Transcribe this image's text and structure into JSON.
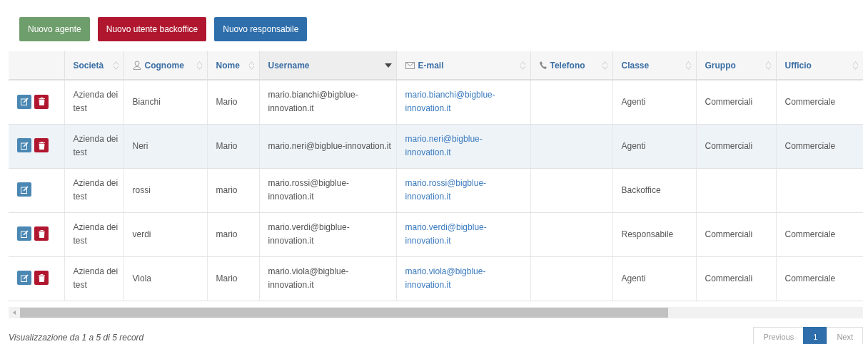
{
  "buttons": [
    {
      "label": "Nuovo agente",
      "color": "#6e9e6b"
    },
    {
      "label": "Nuovo utente backoffice",
      "color": "#b0172f"
    },
    {
      "label": "Nuovo responsabile",
      "color": "#2e6eab"
    }
  ],
  "table": {
    "columns": [
      {
        "label": "Società",
        "kind": "plain",
        "sorted": false
      },
      {
        "label": "Cognome",
        "kind": "user",
        "sorted": false
      },
      {
        "label": "Nome",
        "kind": "plain",
        "sorted": false
      },
      {
        "label": "Username",
        "kind": "plain",
        "sorted": true
      },
      {
        "label": "E-mail",
        "kind": "mail",
        "sorted": false
      },
      {
        "label": "Telefono",
        "kind": "phone",
        "sorted": false
      },
      {
        "label": "Classe",
        "kind": "plain",
        "sorted": false
      },
      {
        "label": "Gruppo",
        "kind": "plain",
        "sorted": false
      },
      {
        "label": "Ufficio",
        "kind": "plain",
        "sorted": false
      }
    ],
    "rows": [
      {
        "selected": false,
        "deletable": true,
        "cells": [
          "Azienda dei test",
          "Bianchi",
          "Mario",
          "mario.bianchi@bigblue-innovation.it",
          "mario.bianchi@bigblue-innovation.it",
          "",
          "Agenti",
          "Commerciali",
          "Commerciale"
        ]
      },
      {
        "selected": true,
        "deletable": true,
        "cells": [
          "Azienda dei test",
          "Neri",
          "Mario",
          "mario.neri@bigblue-innovation.it",
          "mario.neri@bigblue-innovation.it",
          "",
          "Agenti",
          "Commerciali",
          "Commerciale"
        ]
      },
      {
        "selected": false,
        "deletable": false,
        "cells": [
          "Azienda dei test",
          "rossi",
          "mario",
          "mario.rossi@bigblue-innovation.it",
          "mario.rossi@bigblue-innovation.it",
          "",
          "Backoffice",
          "",
          ""
        ]
      },
      {
        "selected": false,
        "deletable": true,
        "cells": [
          "Azienda dei test",
          "verdi",
          "mario",
          "mario.verdi@bigblue-innovation.it",
          "mario.verdi@bigblue-innovation.it",
          "",
          "Responsabile",
          "Commerciali",
          "Commerciale"
        ]
      },
      {
        "selected": false,
        "deletable": true,
        "cells": [
          "Azienda dei test",
          "Viola",
          "Mario",
          "mario.viola@bigblue-innovation.it",
          "mario.viola@bigblue-innovation.it",
          "",
          "Agenti",
          "Commerciali",
          "Commerciale"
        ]
      }
    ]
  },
  "info": "Visualizzazione da 1 a 5 di 5 record",
  "pagination": [
    {
      "label": "Previous",
      "selected": false
    },
    {
      "label": "1",
      "selected": true
    },
    {
      "label": "Next",
      "selected": false
    }
  ]
}
